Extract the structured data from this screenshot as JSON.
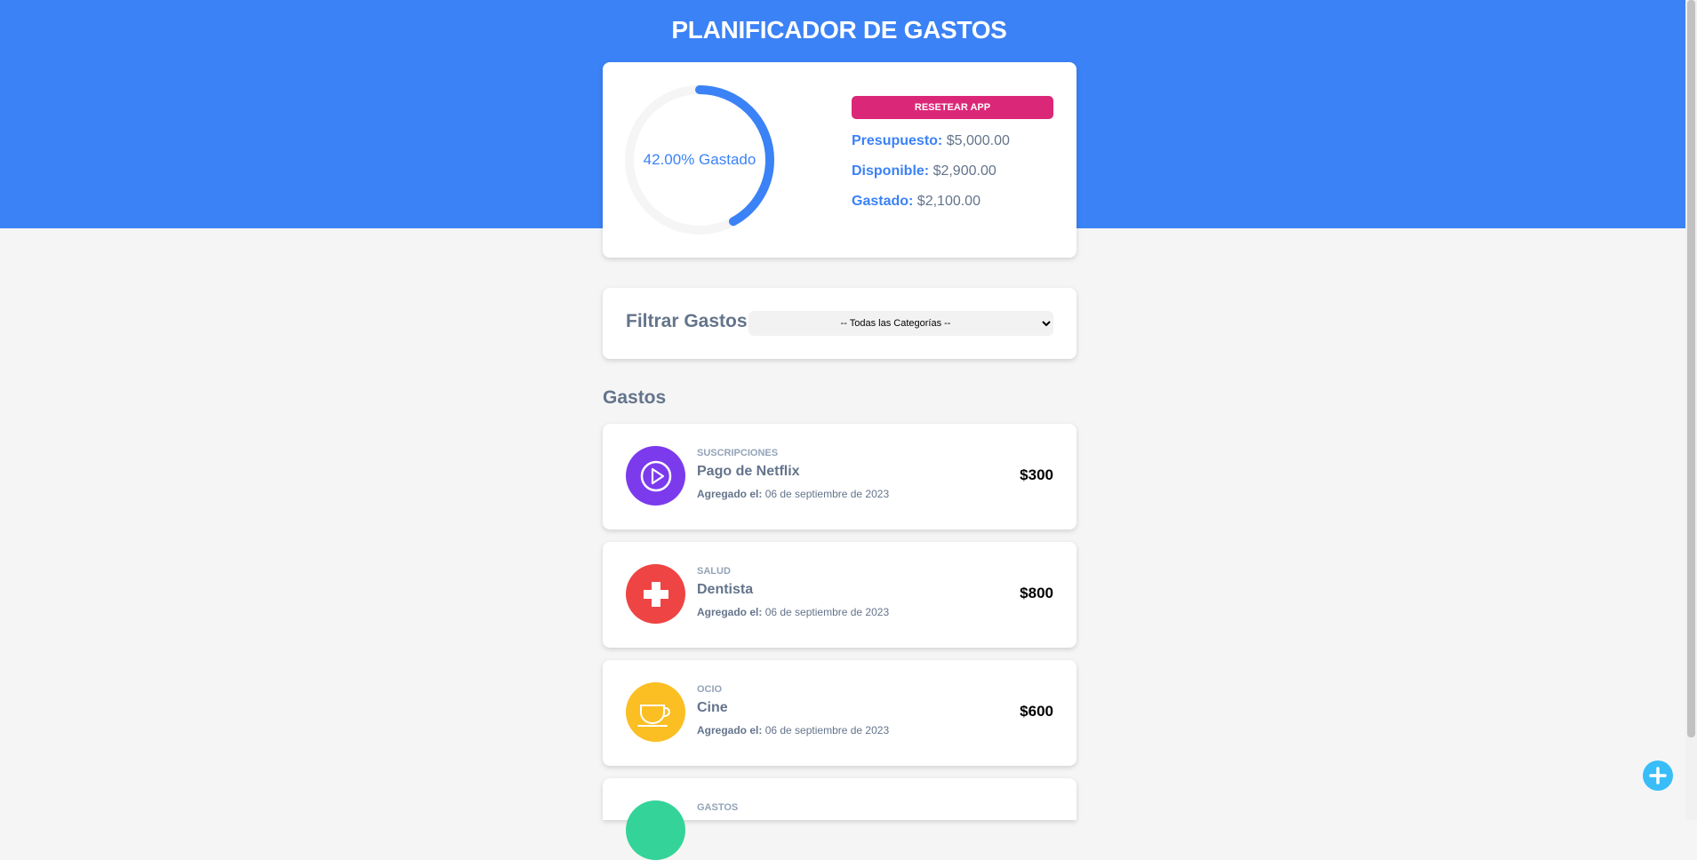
{
  "header": {
    "title": "PLANIFICADOR DE GASTOS"
  },
  "budget": {
    "percent_spent": 42.0,
    "progress_label": "42.00% Gastado",
    "reset_label": "RESETEAR APP",
    "stats": [
      {
        "label": "Presupuesto:",
        "value": "$5,000.00"
      },
      {
        "label": "Disponible:",
        "value": "$2,900.00"
      },
      {
        "label": "Gastado:",
        "value": "$2,100.00"
      }
    ]
  },
  "filter": {
    "label": "Filtrar Gastos",
    "selected": "-- Todas las Categorías --"
  },
  "expenses": {
    "title": "Gastos",
    "date_prefix": "Agregado el:",
    "items": [
      {
        "category": "SUSCRIPCIONES",
        "name": "Pago de Netflix",
        "date": "06 de septiembre de 2023",
        "amount": "$300",
        "icon": "play-icon",
        "color": "#7c3aed"
      },
      {
        "category": "SALUD",
        "name": "Dentista",
        "date": "06 de septiembre de 2023",
        "amount": "$800",
        "icon": "medical-cross-icon",
        "color": "#ef4444"
      },
      {
        "category": "OCIO",
        "name": "Cine",
        "date": "06 de septiembre de 2023",
        "amount": "$600",
        "icon": "coffee-cup-icon",
        "color": "#fbbf24"
      },
      {
        "category": "GASTOS",
        "icon": "category-icon",
        "color": "#34d399"
      }
    ]
  },
  "colors": {
    "primary": "#3b82f6",
    "accent": "#db2777",
    "fab": "#38bdf8"
  }
}
